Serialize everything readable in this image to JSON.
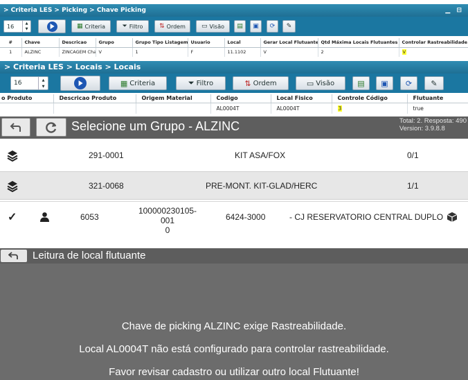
{
  "picking": {
    "breadcrumb": "> Criteria LES > Picking > Chave Picking",
    "window_controls": "▁ ⊟",
    "page_size": "16",
    "toolbar": {
      "criteria": "Criteria",
      "filtro": "Filtro",
      "ordem": "Ordem",
      "visao": "Visão"
    },
    "columns": [
      "#",
      "Chave",
      "Descricao",
      "Grupo",
      "Grupo Tipo Listagem",
      "Usuario",
      "Local",
      "Gerar Local Flutuante",
      "Qtd Máxima Locais Flutuantes",
      "Controlar Rastreabilidade"
    ],
    "row": [
      "1",
      "ALZINC",
      "ZINCAGEM Cha",
      "V",
      "1",
      "F",
      "11.1102",
      "V",
      "2",
      "V"
    ]
  },
  "locais": {
    "breadcrumb": "> Criteria LES > Locais > Locais",
    "page_size": "16",
    "toolbar": {
      "criteria": "Criteria",
      "filtro": "Filtro",
      "ordem": "Ordem",
      "visao": "Visão"
    },
    "columns": [
      "o Produto",
      "Descricao Produto",
      "Origem Material",
      "Codigo",
      "Local Fisico",
      "Controle Código",
      "Flutuante"
    ],
    "row": [
      "",
      "",
      "",
      "AL0004T",
      "AL0004T",
      "3",
      "true"
    ]
  },
  "grupo": {
    "title": "Selecione um Grupo - ALZINC",
    "total": "Total: 2. Resposta: 490",
    "version": "Version: 3.9.8.8",
    "rows": [
      {
        "code": "291-0001",
        "name": "KIT ASA/FOX",
        "qty": "0/1"
      },
      {
        "code": "321-0068",
        "name": "PRE-MONT. KIT-GLAD/HERC",
        "qty": "1/1"
      }
    ]
  },
  "item": {
    "check": "✓",
    "number": "6053",
    "code_line1": "100000230105-001",
    "code_line2": "0",
    "ref": "6424-3000",
    "description": "- CJ RESERVATORIO CENTRAL DUPLO"
  },
  "dialog": {
    "title": "Leitura de local flutuante",
    "messages": [
      "Chave de picking ALZINC exige Rastreabilidade.",
      "Local AL0004T não está configurado para controlar rastreabilidade.",
      "Favor revisar cadastro ou utilizar outro local Flutuante!"
    ]
  },
  "colors": {
    "titlebar": "#1f6f94",
    "toolbar": "#1b77a1",
    "highlight": "#ffff33",
    "dark_bar": "#5e5e5e",
    "dialog_bg": "#6c6c6c"
  }
}
